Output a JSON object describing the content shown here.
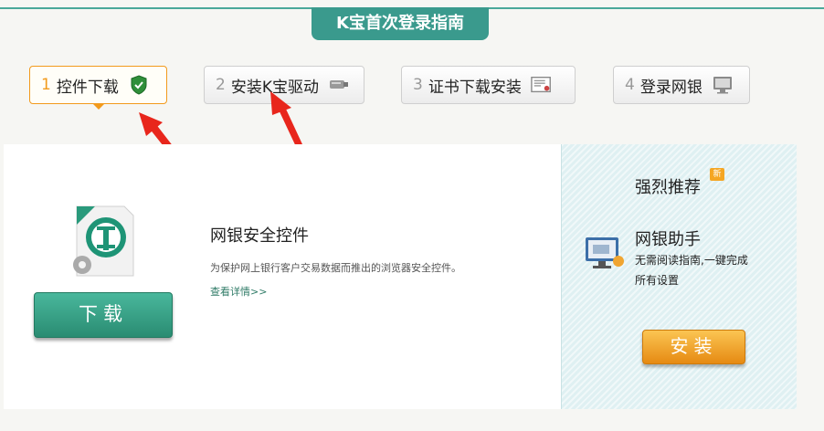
{
  "header": {
    "title": "K宝首次登录指南"
  },
  "steps": [
    {
      "num": "1",
      "label": "控件下载",
      "icon": "shield-icon",
      "active": true
    },
    {
      "num": "2",
      "label": "安装K宝驱动",
      "icon": "usb-key-icon",
      "active": false
    },
    {
      "num": "3",
      "label": "证书下载安装",
      "icon": "certificate-icon",
      "active": false
    },
    {
      "num": "4",
      "label": "登录网银",
      "icon": "monitor-icon",
      "active": false
    }
  ],
  "main": {
    "product_name": "网银安全控件",
    "product_desc": "为保护网上银行客户交易数据而推出的浏览器安全控件。",
    "details_link": "查看详情>>",
    "download_label": "下载"
  },
  "side": {
    "title": "强烈推荐",
    "badge": "新",
    "helper_name": "网银助手",
    "helper_desc": "无需阅读指南,一键完成所有设置",
    "install_label": "安装"
  },
  "colors": {
    "accent_teal": "#3a9a8d",
    "active_orange": "#f29a1c",
    "download_green": "#2a8c72",
    "install_orange": "#e68a12",
    "annotation_red": "#e8261c"
  }
}
